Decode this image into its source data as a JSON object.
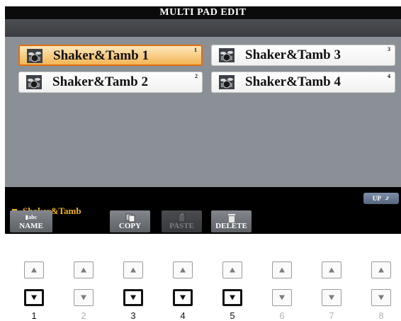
{
  "window": {
    "title": "MULTI PAD EDIT"
  },
  "pads": [
    {
      "name": "Shaker&Tamb 1",
      "number": "1",
      "selected": true,
      "icon": "drum-kit-icon"
    },
    {
      "name": "Shaker&Tamb 2",
      "number": "2",
      "selected": false,
      "icon": "drum-kit-icon"
    },
    {
      "name": "Shaker&Tamb 3",
      "number": "3",
      "selected": false,
      "icon": "drum-kit-icon"
    },
    {
      "name": "Shaker&Tamb 4",
      "number": "4",
      "selected": false,
      "icon": "drum-kit-icon"
    }
  ],
  "path": {
    "label": "Shaker&Tamb",
    "icon": "folder-icon"
  },
  "up_button": {
    "label": "UP"
  },
  "softkeys": {
    "name": {
      "label": "NAME",
      "sublabel": "abc"
    },
    "copy": {
      "label": "COPY"
    },
    "paste": {
      "label": "PASTE",
      "disabled": true
    },
    "delete": {
      "label": "DELETE"
    }
  },
  "hardware": {
    "numbers": [
      "1",
      "2",
      "3",
      "4",
      "5",
      "6",
      "7",
      "8"
    ],
    "active": [
      "1",
      "3",
      "4",
      "5"
    ]
  },
  "colors": {
    "accent_orange": "#e06d10",
    "folder_yellow": "#f2b21c",
    "panel_gray": "#8a9096"
  }
}
